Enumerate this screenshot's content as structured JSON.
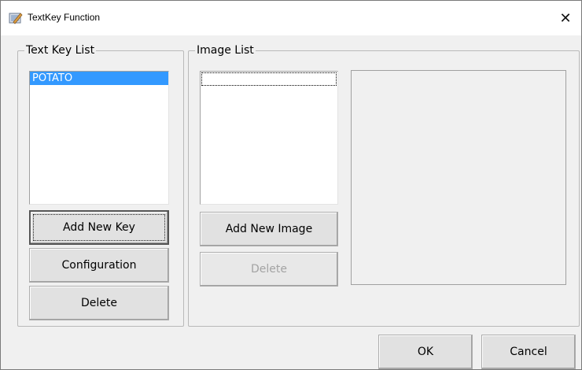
{
  "window": {
    "title": "TextKey Function",
    "close_label": "✕"
  },
  "text_key_group": {
    "legend": "Text Key List",
    "items": [
      "POTATO"
    ],
    "buttons": {
      "add": "Add New Key",
      "config": "Configuration",
      "delete": "Delete"
    }
  },
  "image_group": {
    "legend": "Image List",
    "buttons": {
      "add": "Add New Image",
      "delete": "Delete"
    }
  },
  "footer": {
    "ok": "OK",
    "cancel": "Cancel"
  }
}
